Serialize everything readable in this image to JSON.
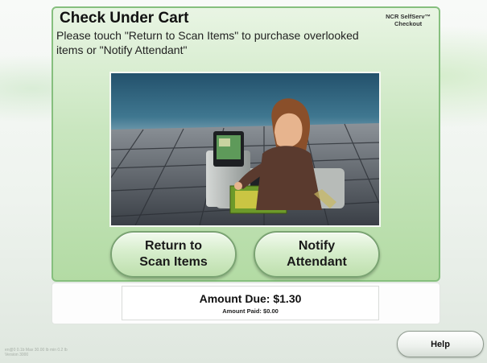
{
  "screen": {
    "title": "Check Under Cart",
    "instructions": "Please touch \"Return to Scan Items\" to purchase overlooked items or \"Notify Attendant\"",
    "brand_line1": "NCR SelfServ™",
    "brand_line2": "Checkout"
  },
  "buttons": {
    "return_label": "Return to\nScan Items",
    "notify_label": "Notify\nAttendant",
    "help_label": "Help"
  },
  "totals": {
    "amount_due": "Amount Due: $1.30",
    "amount_paid": "Amount Paid: $0.00"
  },
  "footer": {
    "status_line1": "en@0 0.1b Max 30.00 lb min 0.2 lb",
    "status_line2": "Version 3000"
  },
  "colors": {
    "panel_green": "#c9e6bf",
    "panel_border": "#86bf7e",
    "button_border": "#7aa372"
  },
  "icons": {
    "scene": "shopper-at-self-checkout-illustration"
  }
}
